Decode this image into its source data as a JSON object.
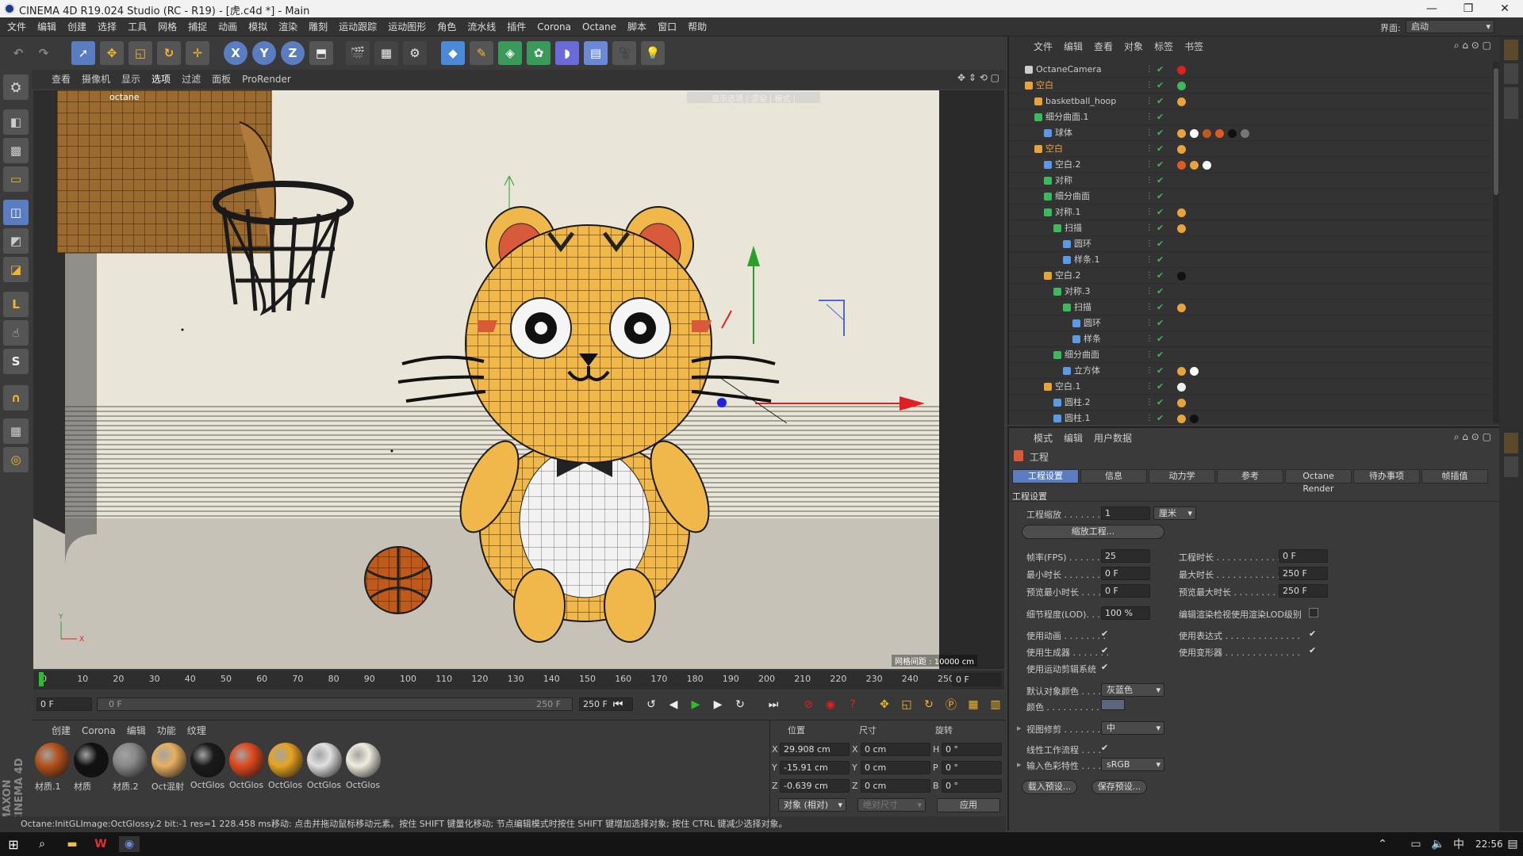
{
  "window": {
    "title": "CINEMA 4D R19.024 Studio (RC - R19) - [虎.c4d *] - Main",
    "minimize": "—",
    "maximize": "❐",
    "close": "✕"
  },
  "menu": [
    "文件",
    "编辑",
    "创建",
    "选择",
    "工具",
    "网格",
    "捕捉",
    "动画",
    "模拟",
    "渲染",
    "雕刻",
    "运动跟踪",
    "运动图形",
    "角色",
    "流水线",
    "插件",
    "Corona",
    "Octane",
    "脚本",
    "窗口",
    "帮助"
  ],
  "interface": {
    "label": "界面:",
    "value": "启动"
  },
  "viewport_menu": [
    "查看",
    "摄像机",
    "显示",
    "选项",
    "过滤",
    "面板",
    "ProRender"
  ],
  "viewport": {
    "camera": "octane",
    "grid_label": "网格间距 : 10000 cm",
    "info_label": "显示选项 | 渲染 | 模式 |"
  },
  "timeline": {
    "ticks": [
      "0",
      "10",
      "20",
      "30",
      "40",
      "50",
      "60",
      "70",
      "80",
      "90",
      "100",
      "110",
      "120",
      "130",
      "140",
      "150",
      "160",
      "170",
      "180",
      "190",
      "200",
      "210",
      "220",
      "230",
      "240",
      "250"
    ],
    "current": "0 F"
  },
  "tlctrl": {
    "start": "0 F",
    "range_start": "0 F",
    "range_end": "250 F",
    "end": "250 F"
  },
  "material_menu": [
    "创建",
    "Corona",
    "编辑",
    "功能",
    "纹理"
  ],
  "materials": [
    {
      "name": "材质.1",
      "color": "#b3521a"
    },
    {
      "name": "材质",
      "color": "#111111"
    },
    {
      "name": "材质.2",
      "color": "#888888"
    },
    {
      "name": "Oct混射",
      "color": "#e7b060"
    },
    {
      "name": "OctGlos",
      "color": "#1a1a1a"
    },
    {
      "name": "OctGlos",
      "color": "#e04a20"
    },
    {
      "name": "OctGlos",
      "color": "#e7a420"
    },
    {
      "name": "OctGlos",
      "color": "#e0e0e0"
    },
    {
      "name": "OctGlos",
      "color": "#f0ece0"
    }
  ],
  "coords": {
    "headers": [
      "位置",
      "尺寸",
      "旋转"
    ],
    "rows": [
      {
        "axis": "X",
        "pos": "29.908 cm",
        "size": "0 cm",
        "raxis": "H",
        "rot": "0 °"
      },
      {
        "axis": "Y",
        "pos": "-15.91 cm",
        "size": "0 cm",
        "raxis": "P",
        "rot": "0 °"
      },
      {
        "axis": "Z",
        "pos": "-0.639 cm",
        "size": "0 cm",
        "raxis": "B",
        "rot": "0 °"
      }
    ],
    "mode": "对象 (相对)",
    "size_mode": "绝对尺寸",
    "apply": "应用"
  },
  "status": {
    "left": "Octane:InitGLImage:OctGlossy.2  bit:-1 res=1  228.458 ms.",
    "hint": "移动: 点击并拖动鼠标移动元素。按住 SHIFT 键量化移动; 节点编辑模式时按住 SHIFT 键增加选择对象; 按住 CTRL 键减少选择对象。"
  },
  "objmgr": {
    "menu": [
      "文件",
      "编辑",
      "查看",
      "对象",
      "标签",
      "书签"
    ],
    "objects": [
      {
        "name": "OctaneCamera",
        "indent": 0,
        "icon": "camera",
        "color": "#cccccc"
      },
      {
        "name": "空白",
        "indent": 0,
        "icon": "null",
        "color": "#e8a33a"
      },
      {
        "name": "basketball_hoop",
        "indent": 1,
        "icon": "null",
        "color": "#cccccc"
      },
      {
        "name": "细分曲面.1",
        "indent": 1,
        "icon": "subdiv",
        "color": "#cccccc"
      },
      {
        "name": "球体",
        "indent": 2,
        "icon": "obj",
        "color": "#cccccc"
      },
      {
        "name": "空白",
        "indent": 1,
        "icon": "null",
        "color": "#e8a33a"
      },
      {
        "name": "空白.2",
        "indent": 2,
        "icon": "obj",
        "color": "#cccccc"
      },
      {
        "name": "对称",
        "indent": 2,
        "icon": "sym",
        "color": "#cccccc"
      },
      {
        "name": "细分曲面",
        "indent": 2,
        "icon": "subdiv",
        "color": "#cccccc"
      },
      {
        "name": "对称.1",
        "indent": 2,
        "icon": "sym",
        "color": "#cccccc"
      },
      {
        "name": "扫描",
        "indent": 3,
        "icon": "sweep",
        "color": "#cccccc"
      },
      {
        "name": "圆环",
        "indent": 4,
        "icon": "circle",
        "color": "#cccccc"
      },
      {
        "name": "样条.1",
        "indent": 4,
        "icon": "spline",
        "color": "#cccccc"
      },
      {
        "name": "空白.2",
        "indent": 2,
        "icon": "null",
        "color": "#cccccc"
      },
      {
        "name": "对称.3",
        "indent": 3,
        "icon": "sym",
        "color": "#cccccc"
      },
      {
        "name": "扫描",
        "indent": 4,
        "icon": "sweep",
        "color": "#cccccc"
      },
      {
        "name": "圆环",
        "indent": 5,
        "icon": "circle",
        "color": "#cccccc"
      },
      {
        "name": "样条",
        "indent": 5,
        "icon": "spline",
        "color": "#cccccc"
      },
      {
        "name": "细分曲面",
        "indent": 3,
        "icon": "subdiv",
        "color": "#cccccc"
      },
      {
        "name": "立方体",
        "indent": 4,
        "icon": "obj",
        "color": "#cccccc"
      },
      {
        "name": "空白.1",
        "indent": 2,
        "icon": "null",
        "color": "#cccccc"
      },
      {
        "name": "圆柱.2",
        "indent": 3,
        "icon": "cyl",
        "color": "#cccccc"
      },
      {
        "name": "圆柱.1",
        "indent": 3,
        "icon": "cyl",
        "color": "#cccccc"
      }
    ]
  },
  "attrmgr": {
    "menu": [
      "模式",
      "编辑",
      "用户数据"
    ],
    "title": "工程",
    "tabs": [
      "工程设置",
      "信息",
      "动力学",
      "参考",
      "Octane Render",
      "待办事项",
      "帧插值"
    ],
    "section": "工程设置",
    "scale_label": "工程缩放 . . . . . . .",
    "scale_value": "1",
    "scale_unit": "厘米",
    "scale_btn": "缩放工程...",
    "fps_label": "帧率(FPS) . . . . . . .",
    "fps": "25",
    "duration_label": "工程时长 . . . . . . . . . . . . . . . .",
    "duration": "0 F",
    "min_label": "最小时长 . . . . . . . .",
    "min": "0 F",
    "max_label": "最大时长 . . . . . . . . . . . . . . . .",
    "max": "250 F",
    "pmin_label": "预览最小时长 . . . .",
    "pmin": "0 F",
    "pmax_label": "预览最大时长 . . . . . . . . . . . . .",
    "pmax": "250 F",
    "lod_label": "细节程度(LOD). . . .",
    "lod": "100 %",
    "lod_check_label": "编辑渲染检视使用渲染LOD级别",
    "anim_label": "使用动画 . . . . . . . .",
    "expr_label": "使用表达式 . . . . . . . . . . . . . .",
    "gen_label": "使用生成器 . . . . . . .",
    "deform_label": "使用变形器 . . . . . . . . . . . . . .",
    "motion_label": "使用运动剪辑系统",
    "defcolor_label": "默认对象颜色 . . . .",
    "defcolor": "灰蓝色",
    "color_label": "颜色 . . . . . . . . . . .",
    "clip_label": "视图修剪 . . . . . . . .",
    "clip": "中",
    "linear_label": "线性工作流程 . . . .",
    "profile_label": "输入色彩特性 . . . .",
    "profile": "sRGB",
    "load_btn": "载入预设...",
    "save_btn": "保存预设..."
  },
  "taskbar": {
    "time": "22:56"
  },
  "colors": {
    "accent": "#e8a33a",
    "selected": "#5a7cc0"
  }
}
